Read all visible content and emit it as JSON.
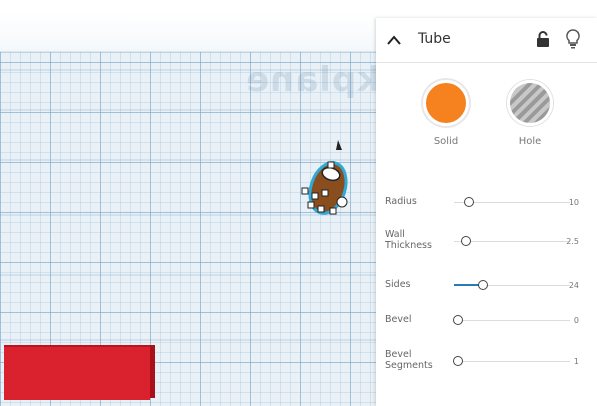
{
  "workplane": {
    "label": "Workplane"
  },
  "inspector": {
    "title": "Tube",
    "types": [
      {
        "label": "Solid",
        "color": "#f5821f",
        "selected": true
      },
      {
        "label": "Hole",
        "color": "#aaaaaa",
        "selected": false
      }
    ],
    "properties": [
      {
        "label": "Radius",
        "value": "10",
        "level": 0.1
      },
      {
        "label": "Wall Thickness",
        "value": "2.5",
        "level": 0.07
      },
      {
        "label": "Sides",
        "value": "24",
        "level": 0.22
      },
      {
        "label": "Bevel",
        "value": "0",
        "level": 0.0
      },
      {
        "label": "Bevel Segments",
        "value": "1",
        "level": 0.0
      }
    ]
  },
  "colors": {
    "accent": "#2a7ab8",
    "solid": "#f5821f",
    "box": "#d9222e",
    "selection": "#2fa9d6"
  }
}
